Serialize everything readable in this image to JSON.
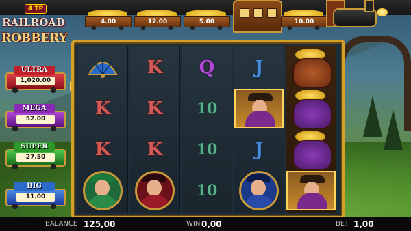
{
  "game": {
    "logo_badge": "4 TP",
    "logo_line1": "RAILROAD",
    "logo_line2": "ROBBERY"
  },
  "train_carts": [
    {
      "value": "4.00"
    },
    {
      "value": "12.00"
    },
    {
      "value": "5.00"
    },
    {
      "value": "10.00"
    }
  ],
  "jackpots": [
    {
      "name": "ULTRA",
      "value": "1,020.00",
      "color": "#c0202a"
    },
    {
      "name": "MEGA",
      "value": "52.00",
      "color": "#8a2ab4"
    },
    {
      "name": "SUPER",
      "value": "27.50",
      "color": "#2a9a2a"
    },
    {
      "name": "BIG",
      "value": "11.00",
      "color": "#2a6ac8"
    }
  ],
  "reels": [
    [
      "fan-icon",
      "K",
      "K",
      "lady-portrait-icon"
    ],
    [
      "K",
      "K",
      "K",
      "gentleman-portrait-icon"
    ],
    [
      "Q",
      "10",
      "10",
      "10"
    ],
    [
      "J",
      "bandit-icon",
      "J",
      "conductor-portrait-icon"
    ],
    [
      "money-bag-icon",
      "money-bag-icon",
      "money-bag-icon",
      "bandit-icon"
    ]
  ],
  "symbol_text": {
    "K": "K",
    "Q": "Q",
    "J": "J",
    "10": "10"
  },
  "bottom_bar": {
    "balance_label": "BALANCE",
    "balance_value": "125,00",
    "win_label": "WIN",
    "win_value": "0,00",
    "bet_label": "BET",
    "bet_value": "1,00"
  }
}
